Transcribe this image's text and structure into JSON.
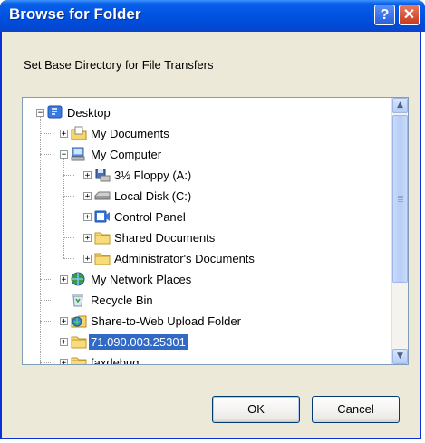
{
  "window": {
    "title": "Browse for Folder",
    "help_glyph": "?",
    "close_glyph": "✕"
  },
  "instruction": "Set Base Directory for File Transfers",
  "tree": [
    {
      "label": "Desktop",
      "icon": "desktop-icon",
      "expander": "−",
      "selected": false
    },
    {
      "label": "My Documents",
      "icon": "my-documents-icon",
      "expander": "+",
      "selected": false
    },
    {
      "label": "My Computer",
      "icon": "my-computer-icon",
      "expander": "−",
      "selected": false
    },
    {
      "label": "3½ Floppy (A:)",
      "icon": "floppy-drive-icon",
      "expander": "+",
      "selected": false
    },
    {
      "label": "Local Disk (C:)",
      "icon": "hard-disk-icon",
      "expander": "+",
      "selected": false
    },
    {
      "label": "Control Panel",
      "icon": "control-panel-icon",
      "expander": "+",
      "selected": false
    },
    {
      "label": "Shared Documents",
      "icon": "folder-icon",
      "expander": "+",
      "selected": false
    },
    {
      "label": "Administrator's Documents",
      "icon": "folder-icon",
      "expander": "+",
      "selected": false
    },
    {
      "label": "My Network Places",
      "icon": "network-places-icon",
      "expander": "+",
      "selected": false
    },
    {
      "label": "Recycle Bin",
      "icon": "recycle-bin-icon",
      "expander": "",
      "selected": false
    },
    {
      "label": "Share-to-Web Upload Folder",
      "icon": "web-folder-icon",
      "expander": "+",
      "selected": false
    },
    {
      "label": "71.090.003.25301",
      "icon": "folder-icon",
      "expander": "+",
      "selected": true
    },
    {
      "label": "faxdebug",
      "icon": "folder-icon",
      "expander": "+",
      "selected": false
    }
  ],
  "scrollbar": {
    "up_glyph": "▲",
    "down_glyph": "▼"
  },
  "buttons": {
    "ok": "OK",
    "cancel": "Cancel"
  },
  "colors": {
    "selection": "#316ac5",
    "titlebar": "#0054e3",
    "dialog": "#ece9d8"
  }
}
